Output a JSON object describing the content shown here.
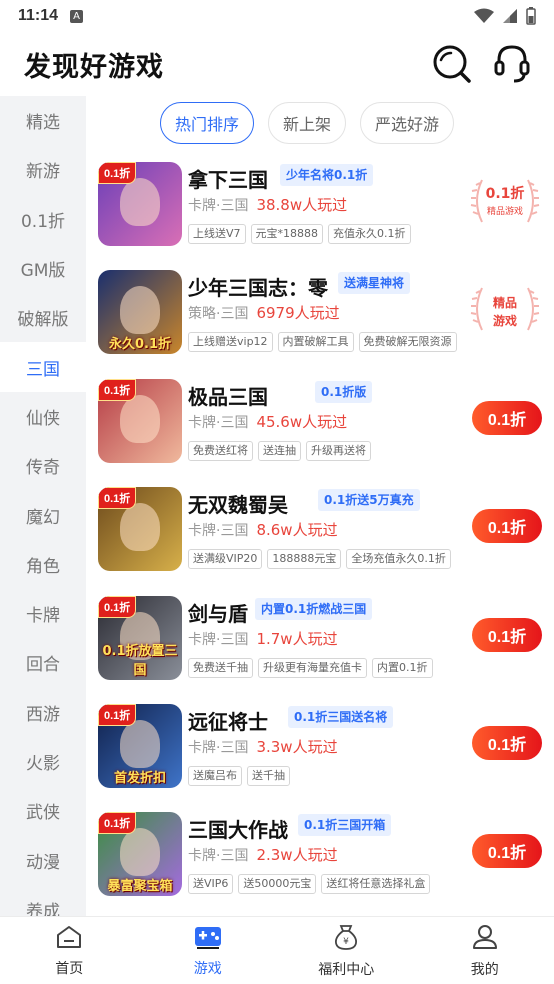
{
  "status": {
    "time": "11:14",
    "a_icon": "A"
  },
  "header": {
    "title": "发现好游戏",
    "search_icon": "search-icon",
    "service_icon": "headset-icon"
  },
  "sidebar": {
    "items": [
      {
        "label": "精选"
      },
      {
        "label": "新游"
      },
      {
        "label": "0.1折"
      },
      {
        "label": "GM版"
      },
      {
        "label": "破解版"
      },
      {
        "label": "三国"
      },
      {
        "label": "仙侠"
      },
      {
        "label": "传奇"
      },
      {
        "label": "魔幻"
      },
      {
        "label": "角色"
      },
      {
        "label": "卡牌"
      },
      {
        "label": "回合"
      },
      {
        "label": "西游"
      },
      {
        "label": "火影"
      },
      {
        "label": "武侠"
      },
      {
        "label": "动漫"
      },
      {
        "label": "养成"
      }
    ],
    "active": "三国"
  },
  "tabs": [
    {
      "label": "热门排序",
      "active": true
    },
    {
      "label": "新上架",
      "active": false
    },
    {
      "label": "严选好游",
      "active": false
    }
  ],
  "games": [
    {
      "name": "拿下三国",
      "tagline": "少年名将0.1折",
      "category": "卡牌·三国",
      "players": "38.8w人玩过",
      "tags": [
        "上线送V7",
        "元宝*18888",
        "充值永久0.1折"
      ],
      "badge": "0.1折",
      "caption": "",
      "action": "stamp",
      "stamp_main": "0.1折",
      "stamp_sub": "精品游戏",
      "cover_colors": [
        "#6b3fb8",
        "#d96fb5"
      ]
    },
    {
      "name": "少年三国志：零",
      "tagline": "送满星神将",
      "category": "策略·三国",
      "players": "6979人玩过",
      "tags": [
        "上线赠送vip12",
        "内置破解工具",
        "免费破解无限资源"
      ],
      "badge": "",
      "caption": "永久0.1折",
      "action": "stamp",
      "stamp_main": "精品",
      "stamp_sub": "游戏",
      "cover_colors": [
        "#1a2f6e",
        "#c9862b"
      ]
    },
    {
      "name": "极品三国",
      "tagline": "0.1折版",
      "category": "卡牌·三国",
      "players": "45.6w人玩过",
      "tags": [
        "免费送红将",
        "送连抽",
        "升级再送将"
      ],
      "badge": "0.1折",
      "caption": "",
      "action": "button",
      "button_label": "0.1折",
      "cover_colors": [
        "#b53c46",
        "#f0b99d"
      ]
    },
    {
      "name": "无双魏蜀吴",
      "tagline": "0.1折送5万真充",
      "category": "卡牌·三国",
      "players": "8.6w人玩过",
      "tags": [
        "送满级VIP20",
        "188888元宝",
        "全场充值永久0.1折"
      ],
      "badge": "0.1折",
      "caption": "",
      "action": "button",
      "button_label": "0.1折",
      "cover_colors": [
        "#6d4a1c",
        "#d7b04a"
      ]
    },
    {
      "name": "剑与盾",
      "tagline": "内置0.1折燃战三国",
      "category": "卡牌·三国",
      "players": "1.7w人玩过",
      "tags": [
        "免费送千抽",
        "升级更有海量充值卡",
        "内置0.1折"
      ],
      "badge": "0.1折",
      "caption": "0.1折放置三国",
      "action": "button",
      "button_label": "0.1折",
      "cover_colors": [
        "#2b2b33",
        "#8a8f99"
      ]
    },
    {
      "name": "远征将士",
      "tagline": "0.1折三国送名将",
      "category": "卡牌·三国",
      "players": "3.3w人玩过",
      "tags": [
        "送魔吕布",
        "送千抽"
      ],
      "badge": "0.1折",
      "caption": "首发折扣",
      "action": "button",
      "button_label": "0.1折",
      "cover_colors": [
        "#10204a",
        "#3f74c9"
      ]
    },
    {
      "name": "三国大作战",
      "tagline": "0.1折三国开箱",
      "category": "卡牌·三国",
      "players": "2.3w人玩过",
      "tags": [
        "送VIP6",
        "送50000元宝",
        "送红将任意选择礼盒"
      ],
      "badge": "0.1折",
      "caption": "暴富聚宝箱",
      "action": "button",
      "button_label": "0.1折",
      "cover_colors": [
        "#3a8f3e",
        "#a56be0"
      ]
    }
  ],
  "bottom_nav": [
    {
      "label": "首页",
      "icon": "home-icon",
      "active": false
    },
    {
      "label": "游戏",
      "icon": "gamepad-icon",
      "active": true
    },
    {
      "label": "福利中心",
      "icon": "gift-bag-icon",
      "active": false
    },
    {
      "label": "我的",
      "icon": "user-icon",
      "active": false
    }
  ],
  "colors": {
    "accent": "#2f6df6",
    "price_red": "#e8453c",
    "sidebar_bg": "#f2f3f5"
  }
}
